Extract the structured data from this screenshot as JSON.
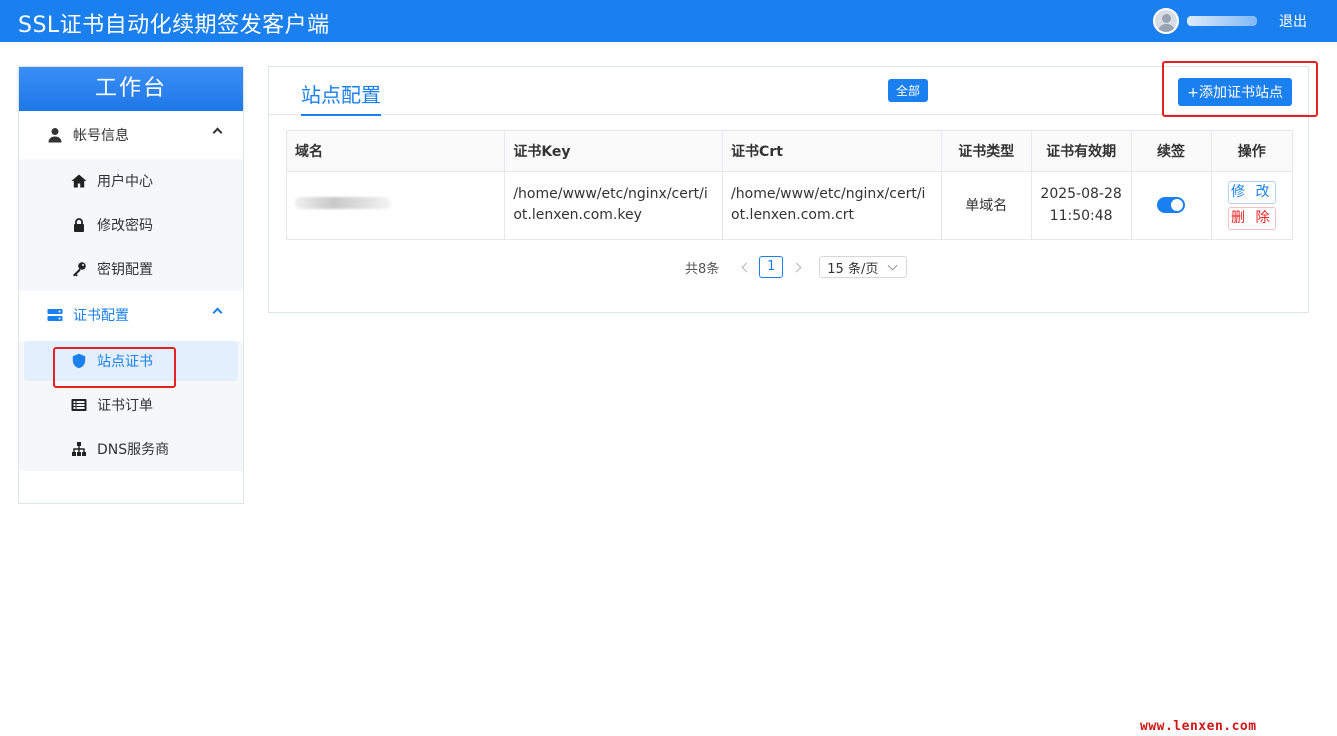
{
  "header": {
    "title": "SSL证书自动化续期签发客户端",
    "logout_label": "退出"
  },
  "sidebar": {
    "title": "工作台",
    "groups": [
      {
        "label": "帐号信息",
        "items": [
          {
            "label": "用户中心",
            "icon": "home-icon"
          },
          {
            "label": "修改密码",
            "icon": "lock-icon"
          },
          {
            "label": "密钥配置",
            "icon": "key-icon"
          }
        ]
      },
      {
        "label": "证书配置",
        "items": [
          {
            "label": "站点证书",
            "icon": "shield-icon"
          },
          {
            "label": "证书订单",
            "icon": "list-icon"
          },
          {
            "label": "DNS服务商",
            "icon": "sitemap-icon"
          }
        ]
      }
    ]
  },
  "main": {
    "tab_label": "站点配置",
    "badge_all": "全部",
    "add_button_label": "+添加证书站点",
    "table": {
      "headers": [
        "域名",
        "证书Key",
        "证书Crt",
        "证书类型",
        "证书有效期",
        "续签",
        "操作"
      ],
      "rows": [
        {
          "key_path": "/home/www/etc/nginx/cert/iot.lenxen.com.key",
          "crt_path": "/home/www/etc/nginx/cert/iot.lenxen.com.crt",
          "cert_type": "单域名",
          "expiry_date": "2025-08-28",
          "expiry_time": "11:50:48",
          "auto_renew": true,
          "edit_label": "修 改",
          "delete_label": "删 除"
        }
      ]
    },
    "pagination": {
      "total_label": "共8条",
      "current_page": "1",
      "page_size_label": "15 条/页"
    }
  },
  "watermark": "www.lenxen.com",
  "colors": {
    "primary": "#1a7fef",
    "danger": "#e52222"
  }
}
